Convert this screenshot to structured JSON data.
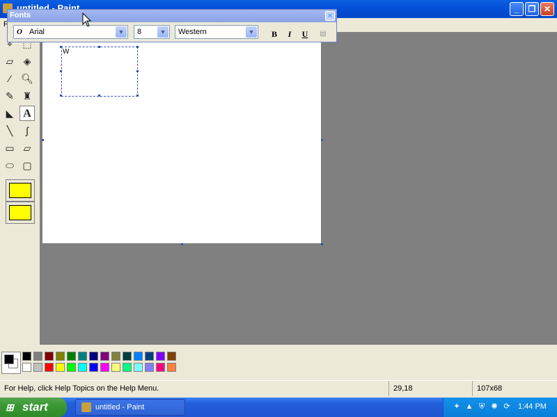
{
  "window": {
    "title": "untitled - Paint"
  },
  "menubar": {
    "first_letter": "F"
  },
  "fonts_toolbar": {
    "title": "Fonts",
    "font_name": "Arial",
    "font_size": "8",
    "script": "Western",
    "bold_label": "B",
    "italic_label": "I",
    "underline_label": "U"
  },
  "canvas": {
    "text_content": "W"
  },
  "status": {
    "help_text": "For Help, click Help Topics on the Help Menu.",
    "coords": "29,18",
    "size": "107x68"
  },
  "palette": {
    "foreground": "#000000",
    "background": "#ffffff",
    "row1": [
      "#000000",
      "#808080",
      "#800000",
      "#808000",
      "#008000",
      "#008080",
      "#000080",
      "#800080",
      "#808040",
      "#004040",
      "#0080ff",
      "#004080",
      "#8000ff",
      "#804000"
    ],
    "row2": [
      "#ffffff",
      "#c0c0c0",
      "#ff0000",
      "#ffff00",
      "#00ff00",
      "#00ffff",
      "#0000ff",
      "#ff00ff",
      "#ffff80",
      "#00ff80",
      "#80ffff",
      "#8080ff",
      "#ff0080",
      "#ff8040"
    ]
  },
  "taskbar": {
    "start_label": "start",
    "task_label": "untitled - Paint",
    "clock": "1:44 PM"
  }
}
